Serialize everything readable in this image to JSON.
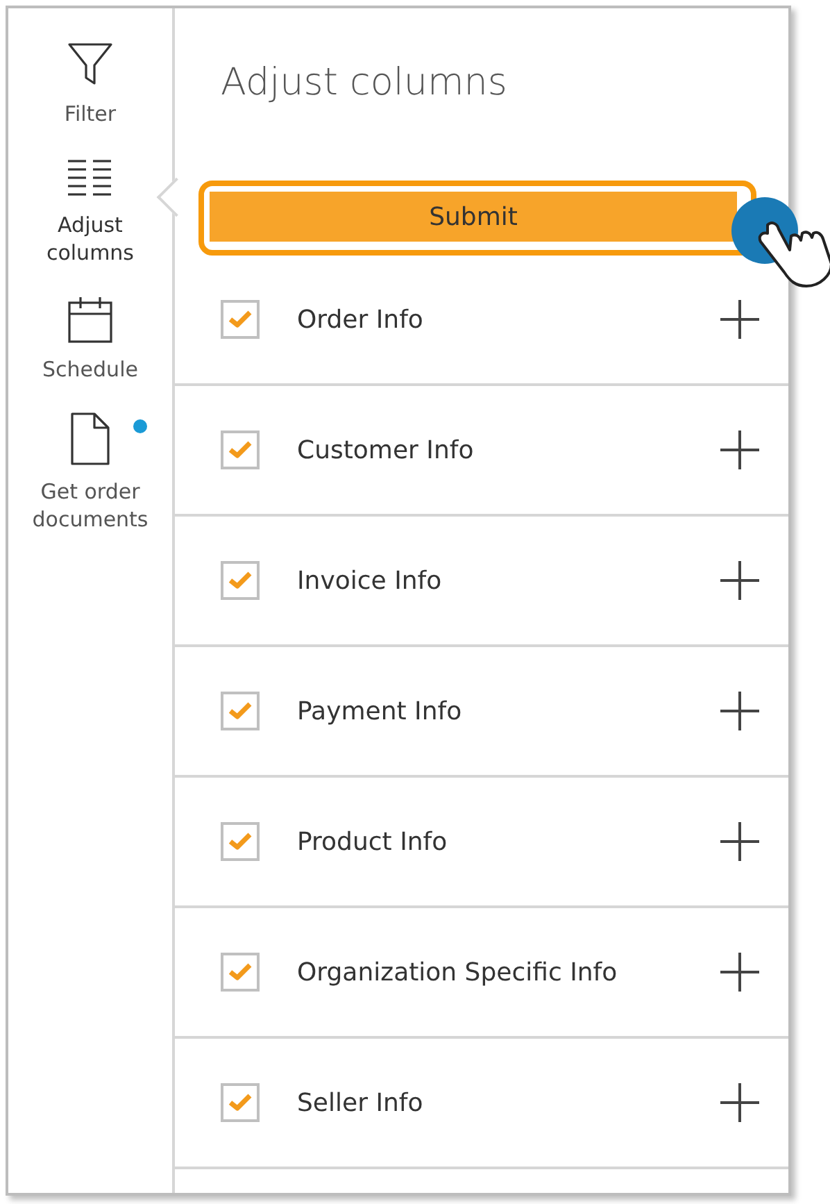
{
  "sidebar": {
    "items": [
      {
        "kind": "filter",
        "label": "Filter",
        "selected": false,
        "notification": false
      },
      {
        "kind": "columns",
        "label": "Adjust columns",
        "selected": true,
        "notification": false
      },
      {
        "kind": "calendar",
        "label": "Schedule",
        "selected": false,
        "notification": false
      },
      {
        "kind": "document",
        "label": "Get order documents",
        "selected": false,
        "notification": true
      }
    ]
  },
  "panel": {
    "title": "Adjust columns",
    "submit": {
      "label": "Submit",
      "highlighted": true
    },
    "rows": [
      {
        "label": "Order Info",
        "checked": true
      },
      {
        "label": "Customer Info",
        "checked": true
      },
      {
        "label": "Invoice Info",
        "checked": true
      },
      {
        "label": "Payment Info",
        "checked": true
      },
      {
        "label": "Product Info",
        "checked": true
      },
      {
        "label": "Organization Specific Info",
        "checked": true
      },
      {
        "label": "Seller Info",
        "checked": true
      }
    ]
  }
}
